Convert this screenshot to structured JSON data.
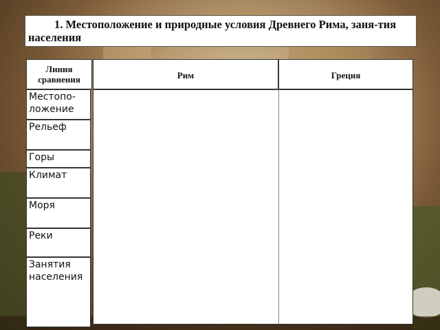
{
  "slide": {
    "title": "1. Местоположение и природные условия Древнего Рима, заня-тия населения"
  },
  "table": {
    "header_comparison": "Линия сравнения",
    "header_rome": "Рим",
    "header_greece": "Греция",
    "rows": [
      {
        "label": "Местопо-ложение"
      },
      {
        "label": "Рельеф"
      },
      {
        "label": "Горы"
      },
      {
        "label": "Климат"
      },
      {
        "label": "Моря"
      },
      {
        "label": "Реки"
      },
      {
        "label": "Занятия населения"
      }
    ]
  }
}
